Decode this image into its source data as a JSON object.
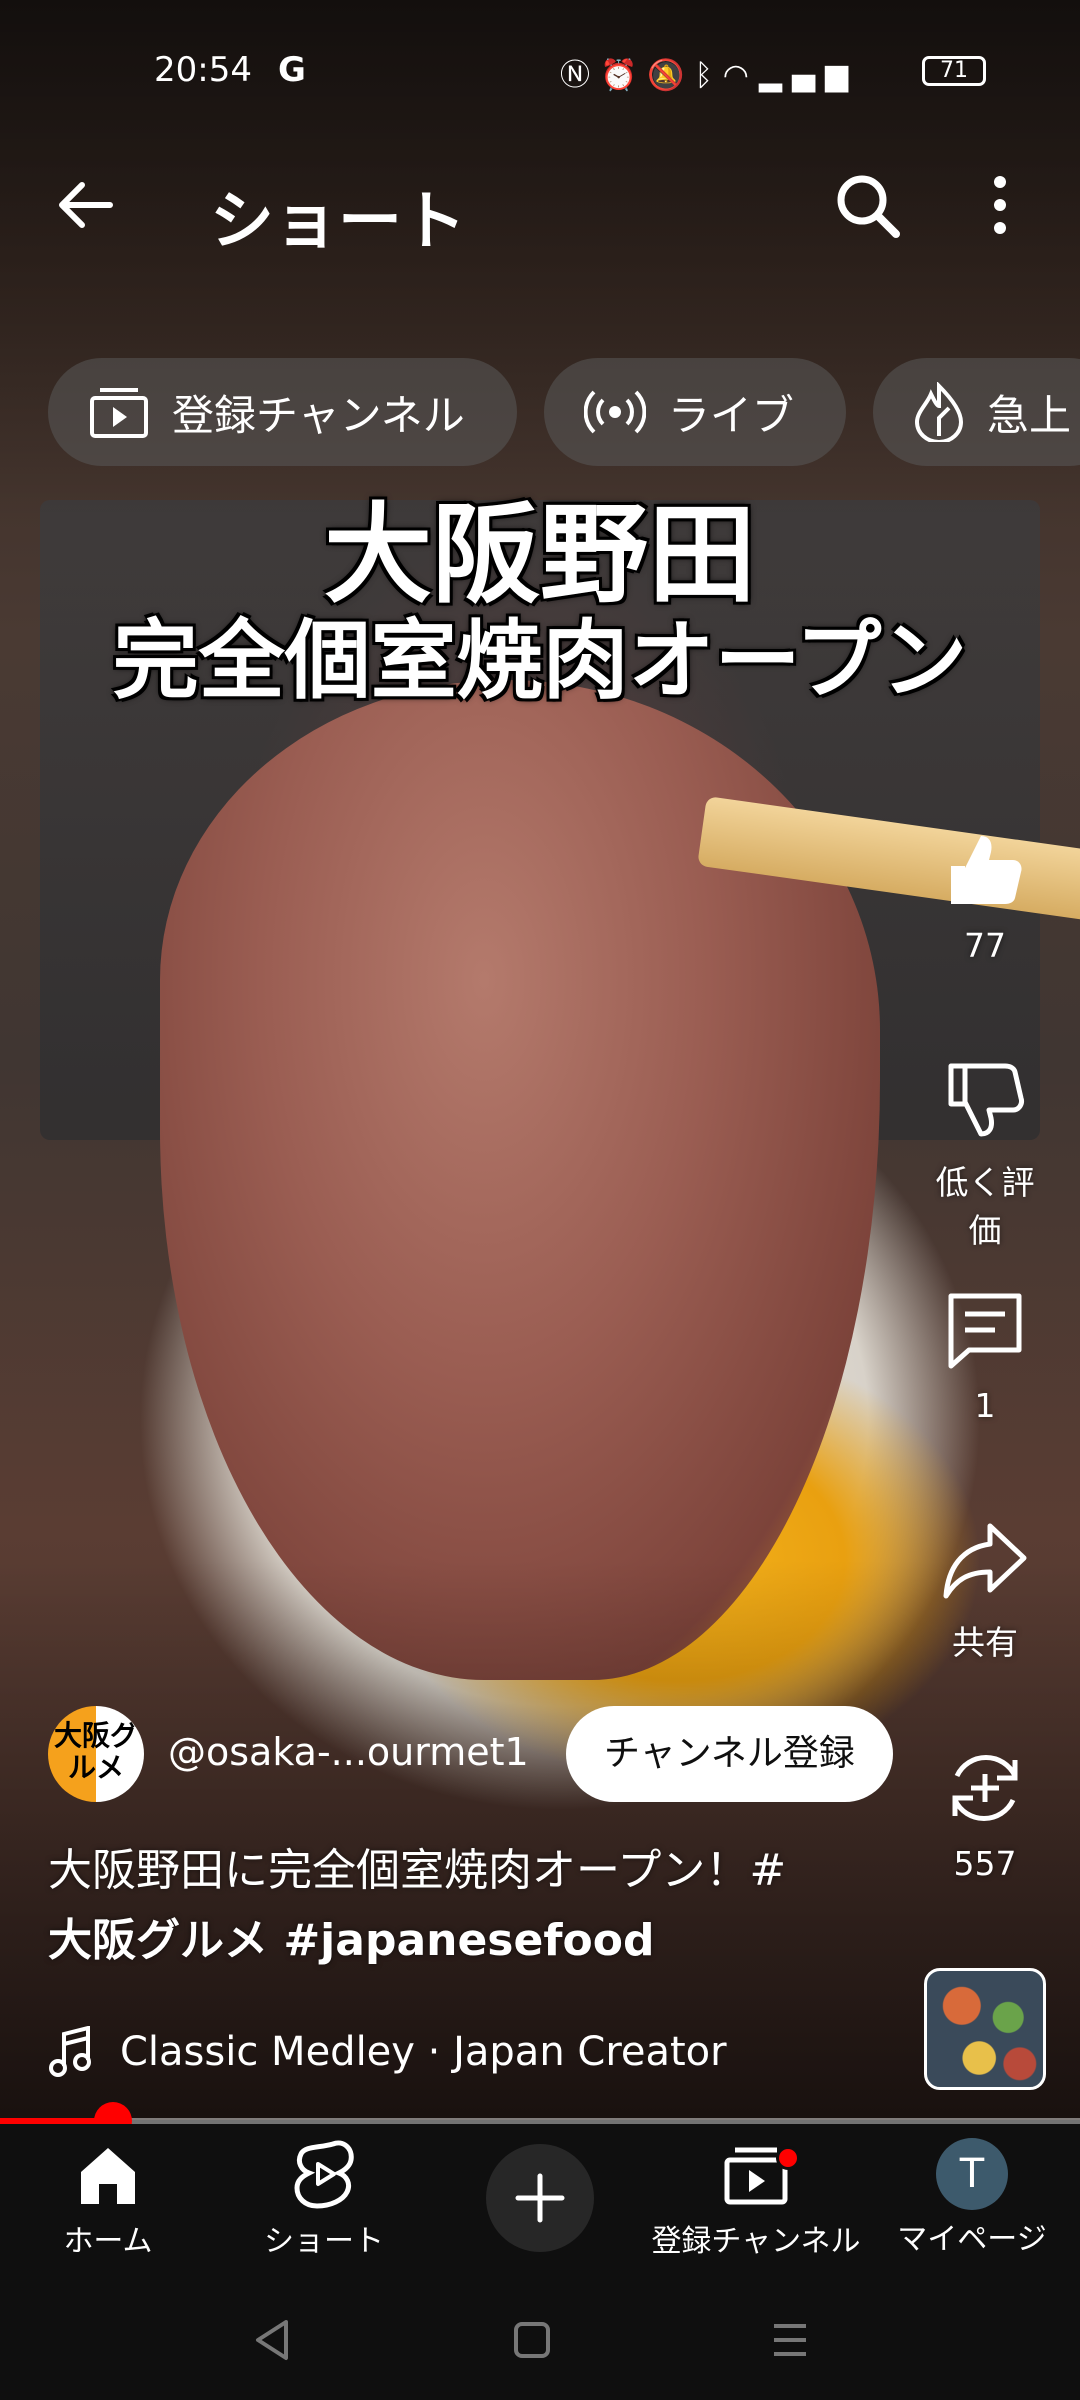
{
  "status_bar": {
    "time": "20:54",
    "g_label": "G",
    "battery": "71"
  },
  "header": {
    "title": "ショート"
  },
  "chips": [
    {
      "label": "登録チャンネル",
      "icon": "subscriptions-icon"
    },
    {
      "label": "ライブ",
      "icon": "live-icon"
    },
    {
      "label": "急上",
      "icon": "trending-icon"
    }
  ],
  "video": {
    "overlay_line1": "大阪野田",
    "overlay_line2": "完全個室焼肉オープン"
  },
  "actions": {
    "like_count": "77",
    "dislike_label": "低く評価",
    "comment_count": "1",
    "share_label": "共有",
    "remix_count": "557"
  },
  "channel": {
    "avatar_text": "大阪グルメ",
    "handle": "@osaka-...ourmet1",
    "subscribe_label": "チャンネル登録"
  },
  "description": {
    "text": "大阪野田に完全個室焼肉オープン！#",
    "hashtags": "大阪グルメ #japanesefood"
  },
  "music": {
    "label": "Classic Medley · Japan Creator"
  },
  "progress": {
    "fraction": 0.105
  },
  "nav": {
    "home": "ホーム",
    "shorts": "ショート",
    "subscriptions": "登録チャンネル",
    "me": "マイページ",
    "me_initial": "T"
  },
  "colors": {
    "accent": "#ff0000",
    "navbar_bg": "#0f0f0f"
  }
}
